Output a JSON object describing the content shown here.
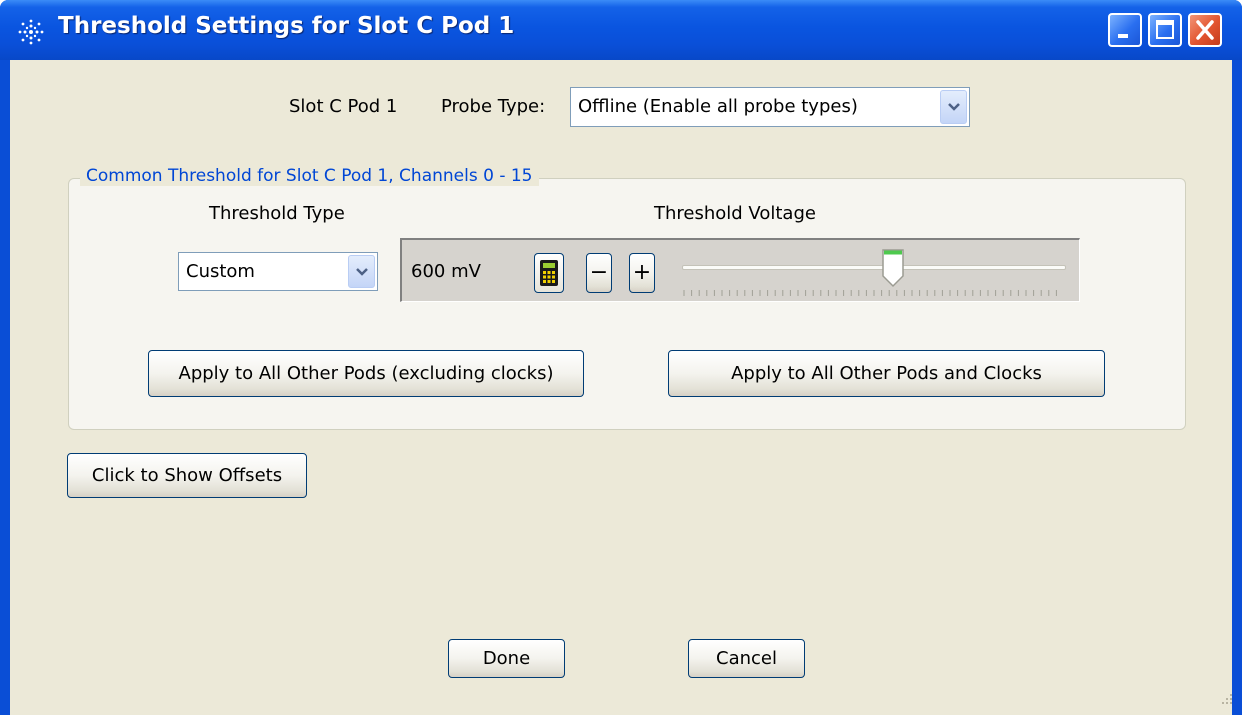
{
  "window": {
    "title": "Threshold Settings for Slot C Pod 1"
  },
  "header": {
    "slot_label": "Slot C Pod 1",
    "probe_type_label": "Probe Type:",
    "probe_type_value": "Offline (Enable all probe types)"
  },
  "group": {
    "legend": "Common Threshold for Slot C Pod 1, Channels 0 - 15",
    "threshold_type_label": "Threshold Type",
    "threshold_voltage_label": "Threshold Voltage",
    "threshold_type_value": "Custom",
    "voltage_value": "600 mV",
    "minus_label": "−",
    "plus_label": "+",
    "slider_position": 0.55,
    "apply_excluding_label": "Apply to All Other Pods (excluding clocks)",
    "apply_all_label": "Apply to All Other Pods and Clocks"
  },
  "show_offsets_label": "Click to Show Offsets",
  "footer": {
    "done_label": "Done",
    "cancel_label": "Cancel"
  },
  "colors": {
    "title_bar": "#0a4ed6",
    "client_bg": "#ece9d8",
    "legend_text": "#0046d5",
    "button_border": "#003c74",
    "close_button": "#e2542f"
  }
}
